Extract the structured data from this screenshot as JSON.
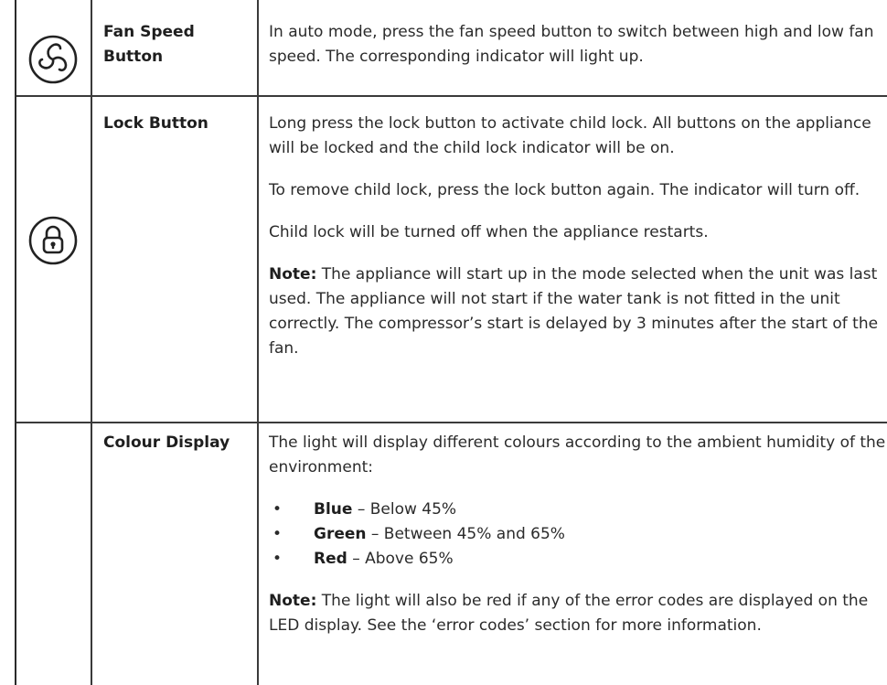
{
  "rows": [
    {
      "label": "Fan Speed Button",
      "icon": "fan-icon",
      "desc": [
        "In auto mode, press the fan speed button to switch between high and low fan speed. The corresponding indicator will light up."
      ]
    },
    {
      "label": "Lock Button",
      "icon": "lock-icon",
      "p1": "Long press the lock button to activate child lock. All buttons on the appliance will be locked and the child lock indicator will be on.",
      "p2": "To remove child lock, press the lock button again. The indicator will turn off.",
      "p3": "Child lock will be turned off when the appliance restarts.",
      "note_label": "Note:",
      "note_text": " The appliance will start up in the mode selected when the unit was last used. The appliance will not start if the water tank is not fitted in the unit correctly. The compressor’s start is delayed by 3 minutes after the start of the fan."
    },
    {
      "label": "Colour Display",
      "intro": "The light will display different colours according to the ambient humidity of the environment:",
      "bullets": [
        {
          "name": "Blue",
          "text": " – Below 45%"
        },
        {
          "name": "Green",
          "text": " – Between 45% and 65%"
        },
        {
          "name": "Red",
          "text": " – Above 65%"
        }
      ],
      "note_label": "Note:",
      "note_text": " The light will also be red if any of the error codes are displayed on the LED display. See the ‘error codes’ section for more information."
    }
  ]
}
